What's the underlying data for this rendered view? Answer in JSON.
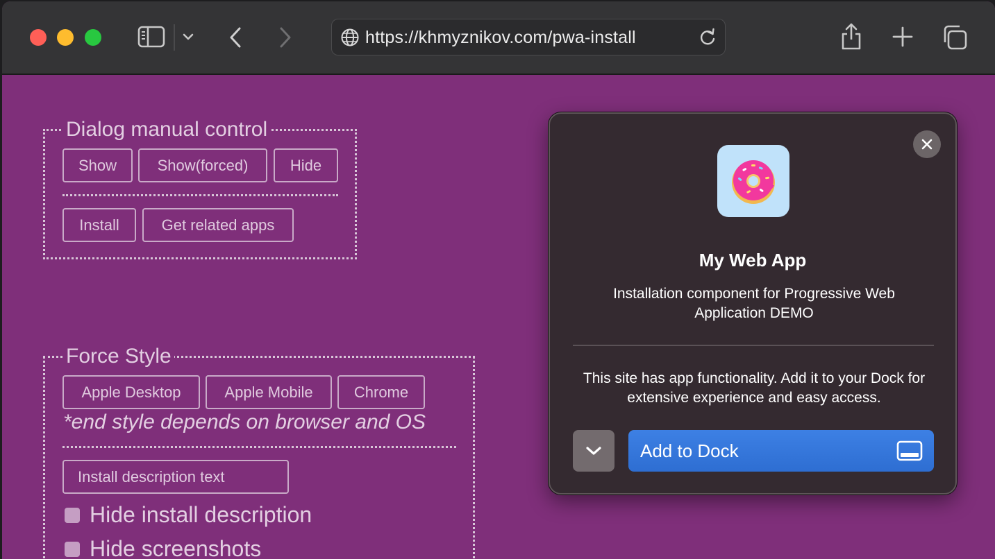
{
  "browser": {
    "url": "https://khmyznikov.com/pwa-install",
    "icons": [
      "sidebar-icon",
      "chevron-down-icon",
      "back-icon",
      "forward-icon",
      "globe-icon",
      "reload-icon",
      "share-icon",
      "new-tab-icon",
      "tabs-overview-icon"
    ]
  },
  "dialog_control": {
    "legend": "Dialog manual control",
    "buttons": [
      "Show",
      "Show(forced)",
      "Hide"
    ],
    "buttons2": [
      "Install",
      "Get related apps"
    ]
  },
  "force_style": {
    "legend": "Force Style",
    "buttons": [
      "Apple Desktop",
      "Apple Mobile",
      "Chrome"
    ],
    "note": "*end style depends on browser and OS",
    "install_desc_button": "Install description text",
    "checkboxes": [
      "Hide install description",
      "Hide screenshots"
    ]
  },
  "install_dialog": {
    "app_name": "My Web App",
    "description": "Installation component for Progressive Web Application DEMO",
    "info": "This site has app functionality. Add it to your Dock for extensive experience and easy access.",
    "add_button": "Add to Dock",
    "app_icon": "donut-icon"
  },
  "colors": {
    "page_bg": "#7f2f7a",
    "dialog_bg": "#342a30",
    "accent_blue": "#3d80e4",
    "app_icon_bg": "#c0e2fa"
  }
}
